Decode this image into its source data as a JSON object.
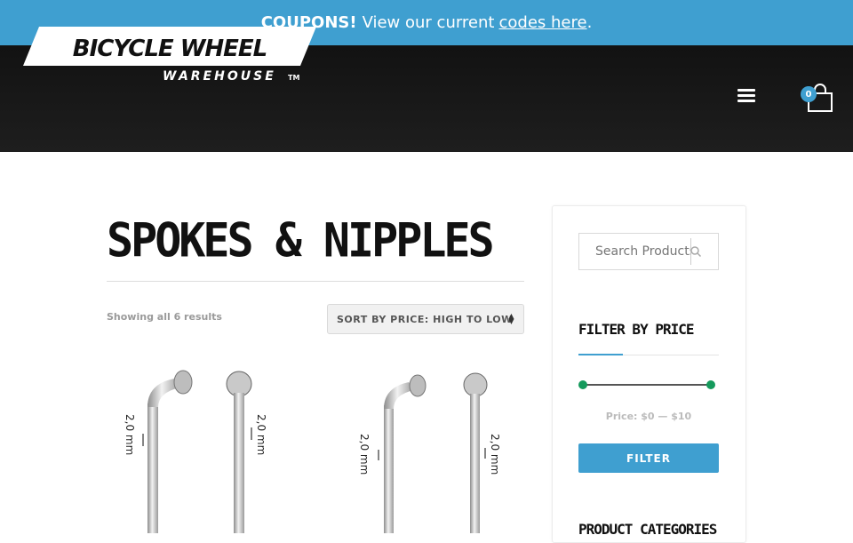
{
  "topbar": {
    "strong": "COUPONS!",
    "text": "View our current",
    "link": "codes here",
    "end": "."
  },
  "header": {
    "logo_main": "BICYCLE WHEEL",
    "logo_sub": "WAREHOUSE",
    "logo_tm": "TM",
    "cart_count": "0"
  },
  "main": {
    "title": "SPOKES & NIPPLES",
    "results": "Showing all 6 results",
    "sort_label": "SORT BY PRICE: HIGH TO LOW",
    "products": [
      {
        "label_left": "2,0 mm",
        "label_right": "2,0 mm"
      },
      {
        "label_left": "2,0 mm",
        "label_right": "2,0 mm"
      }
    ]
  },
  "sidebar": {
    "search_placeholder": "Search Products...",
    "filter_title": "FILTER BY PRICE",
    "price_label": "Price: $0 — $10",
    "price_min": 0,
    "price_max": 10,
    "filter_button": "FILTER",
    "categories_title": "PRODUCT CATEGORIES"
  },
  "colors": {
    "accent": "#3f9fd0",
    "slider_handle": "#159a5c",
    "header_bg": "#161616"
  }
}
